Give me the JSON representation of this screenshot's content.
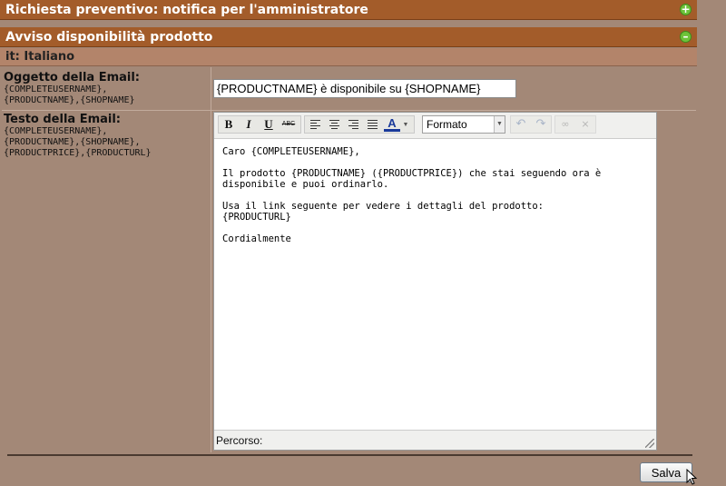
{
  "sections": {
    "collapsed_title": "Richiesta preventivo: notifica per l'amministratore",
    "collapsed_icon": "plus-icon",
    "expanded_title": "Avviso disponibilità prodotto",
    "expanded_icon": "minus-icon"
  },
  "language": "it: Italiano",
  "subject": {
    "label": "Oggetto della Email:",
    "vars": "{COMPLETEUSERNAME},\n{PRODUCTNAME},{SHOPNAME}",
    "value": "{PRODUCTNAME} è disponibile su {SHOPNAME}"
  },
  "body": {
    "label": "Testo della Email:",
    "vars": "{COMPLETEUSERNAME},\n{PRODUCTNAME},{SHOPNAME},\n{PRODUCTPRICE},{PRODUCTURL}",
    "paragraphs": [
      "Caro {COMPLETEUSERNAME},",
      "Il prodotto {PRODUCTNAME} ({PRODUCTPRICE}) che stai seguendo ora è\ndisponibile e puoi ordinarlo.",
      "Usa il link seguente per vedere i dettagli del prodotto:\n{PRODUCTURL}",
      "Cordialmente"
    ]
  },
  "toolbar": {
    "bold": "B",
    "italic": "I",
    "underline": "U",
    "strike": "ABC",
    "color": "A",
    "format": "Formato"
  },
  "status_path": "Percorso:",
  "save_label": "Salva",
  "colors": {
    "header_bar": "#a35c2a",
    "background": "#a38877",
    "icon_green": "#6ec23a"
  }
}
